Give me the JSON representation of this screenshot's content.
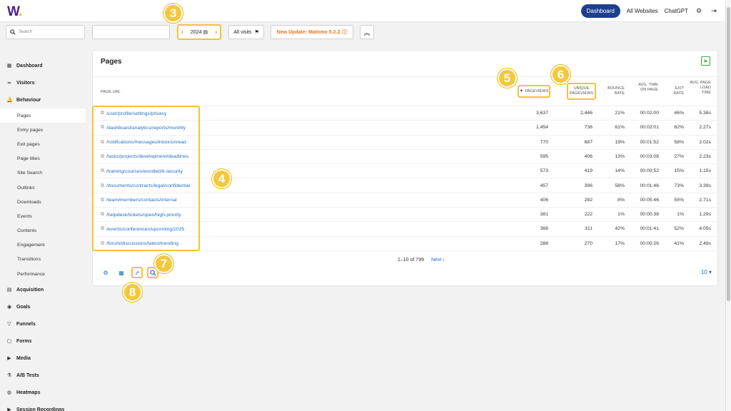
{
  "brand": {
    "logo_text": "W",
    "logo_dot": "."
  },
  "topnav": {
    "dashboard": "Dashboard",
    "all_websites": "All Websites",
    "chatgpt": "ChatGPT"
  },
  "toolbar": {
    "search_placeholder": "Search",
    "date": "2024",
    "segment": "All visits",
    "update": "New Update: Matomo 5.2.2"
  },
  "sidebar": [
    {
      "label": "Dashboard",
      "type": "cat",
      "icon": "dashboard-icon"
    },
    {
      "label": "Visitors",
      "type": "cat",
      "icon": "visitors-icon"
    },
    {
      "label": "Behaviour",
      "type": "cat",
      "icon": "behaviour-icon"
    },
    {
      "label": "Pages",
      "type": "sub",
      "active": true
    },
    {
      "label": "Entry pages",
      "type": "sub"
    },
    {
      "label": "Exit pages",
      "type": "sub"
    },
    {
      "label": "Page titles",
      "type": "sub"
    },
    {
      "label": "Site Search",
      "type": "sub"
    },
    {
      "label": "Outlinks",
      "type": "sub"
    },
    {
      "label": "Downloads",
      "type": "sub"
    },
    {
      "label": "Events",
      "type": "sub"
    },
    {
      "label": "Contents",
      "type": "sub"
    },
    {
      "label": "Engagement",
      "type": "sub"
    },
    {
      "label": "Transitions",
      "type": "sub"
    },
    {
      "label": "Performance",
      "type": "sub"
    },
    {
      "label": "Acquisition",
      "type": "cat",
      "icon": "acquisition-icon"
    },
    {
      "label": "Goals",
      "type": "cat",
      "icon": "goals-icon"
    },
    {
      "label": "Funnels",
      "type": "cat",
      "icon": "funnels-icon"
    },
    {
      "label": "Forms",
      "type": "cat",
      "icon": "forms-icon"
    },
    {
      "label": "Media",
      "type": "cat",
      "icon": "media-icon"
    },
    {
      "label": "A/B Tests",
      "type": "cat",
      "icon": "ab-tests-icon"
    },
    {
      "label": "Heatmaps",
      "type": "cat",
      "icon": "heatmaps-icon"
    },
    {
      "label": "Session Recordings",
      "type": "cat",
      "icon": "session-recordings-icon"
    }
  ],
  "report": {
    "title": "Pages",
    "columns": {
      "url": "PAGE URL",
      "pageviews": "PAGEVIEWS",
      "unique_pageviews": "UNIQUE PAGEVIEWS",
      "bounce_rate": "BOUNCE RATE",
      "avg_time": "AVG. TIME ON PAGE",
      "exit_rate": "EXIT RATE",
      "avg_load": "AVG. PAGE LOAD TIME"
    },
    "rows": [
      {
        "url": "/user/profile/settings/privacy",
        "pv": "3,637",
        "upv": "2,446",
        "br": "21%",
        "at": "00:02:00",
        "er": "46%",
        "plt": "5.38s"
      },
      {
        "url": "/dashboard/analytics/reports/monthly",
        "pv": "1,454",
        "upv": "736",
        "br": "61%",
        "at": "00:02:01",
        "er": "82%",
        "plt": "2.27s"
      },
      {
        "url": "/notifications/messages/inbox/unread",
        "pv": "770",
        "upv": "687",
        "br": "19%",
        "at": "00:01:52",
        "er": "58%",
        "plt": "2.02s"
      },
      {
        "url": "/tasks/projects/development/deadlines",
        "pv": "595",
        "upv": "406",
        "br": "13%",
        "at": "00:03:08",
        "er": "27%",
        "plt": "2.23s"
      },
      {
        "url": "/training/courses/enrolled/it-security",
        "pv": "573",
        "upv": "419",
        "br": "14%",
        "at": "00:00:52",
        "er": "15%",
        "plt": "1.15s"
      },
      {
        "url": "/documents/contracts/legal/confidential",
        "pv": "457",
        "upv": "396",
        "br": "58%",
        "at": "00:01:46",
        "er": "73%",
        "plt": "3.39s"
      },
      {
        "url": "/team/members/contacts/internal",
        "pv": "406",
        "upv": "282",
        "br": "8%",
        "at": "00:05:46",
        "er": "55%",
        "plt": "2.71s"
      },
      {
        "url": "/helpdesk/tickets/open/high-priority",
        "pv": "381",
        "upv": "222",
        "br": "1%",
        "at": "00:00:38",
        "er": "1%",
        "plt": "1.29s"
      },
      {
        "url": "/events/conferences/upcoming/2025",
        "pv": "366",
        "upv": "311",
        "br": "42%",
        "at": "00:01:41",
        "er": "52%",
        "plt": "4.05s"
      },
      {
        "url": "/forum/discussions/latest/trending",
        "pv": "288",
        "upv": "270",
        "br": "17%",
        "at": "00:00:26",
        "er": "41%",
        "plt": "2.49s"
      }
    ],
    "pagination": "1–10 of 799",
    "next": "Next ›",
    "limit": "10"
  },
  "badges": [
    "3",
    "4",
    "5",
    "6",
    "7",
    "8"
  ],
  "colors": {
    "accent": "#1d3f8c",
    "link": "#1f6fc5",
    "highlight": "#f3c23b",
    "update": "#e8751a",
    "export": "#43a047"
  }
}
